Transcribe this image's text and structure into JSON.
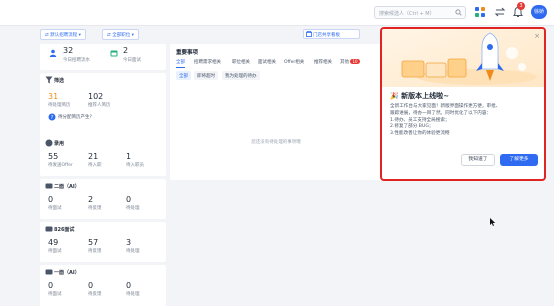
{
  "colors": {
    "accent": "#2e6bf0",
    "highlight": "#e02424",
    "orange": "#f08c1b"
  },
  "topbar": {
    "search_placeholder": "搜索候选人（Ctrl + M）",
    "notification_count": "3",
    "avatar_label": "徐娇"
  },
  "filters": {
    "process_label": "默认招聘流程",
    "position_label": "全部职位"
  },
  "summary": {
    "new_count": "32",
    "new_label": "今日招聘流水",
    "interview_count": "2",
    "interview_label": "今日面试"
  },
  "screening": {
    "title": "筛选",
    "pending_count": "31",
    "pending_label": "待处理简历",
    "recommend_count": "102",
    "recommend_label": "推荐人简历",
    "hint": "待分配简历产生?"
  },
  "hiring": {
    "title": "录用",
    "items": [
      {
        "value": "55",
        "label": "待发送Offer"
      },
      {
        "value": "21",
        "label": "待入职"
      },
      {
        "value": "1",
        "label": "待入职员"
      }
    ]
  },
  "round2": {
    "title": "二面（AI）",
    "items": [
      {
        "value": "0",
        "label": "待面试"
      },
      {
        "value": "2",
        "label": "待反馈"
      },
      {
        "value": "0",
        "label": "待处理"
      }
    ]
  },
  "round826": {
    "title": "826面试",
    "items": [
      {
        "value": "49",
        "label": "待面试"
      },
      {
        "value": "57",
        "label": "待反馈"
      },
      {
        "value": "3",
        "label": "待处理"
      }
    ]
  },
  "round1": {
    "title": "一面（AI）",
    "items": [
      {
        "value": "0",
        "label": "待面试"
      },
      {
        "value": "0",
        "label": "待反馈"
      },
      {
        "value": "0",
        "label": "待处理"
      }
    ]
  },
  "todo": {
    "task_button": "门店共享看板",
    "title": "重要事项",
    "tabs": [
      "全部",
      "招聘需求相关",
      "职位相关",
      "面试相关",
      "Offer相关",
      "推荐相关",
      "其他"
    ],
    "other_badge": "10",
    "chips": [
      "全部",
      "即将超时",
      "我为处理的待办"
    ],
    "empty_text": "您还没有待处理的事项哦"
  },
  "popup": {
    "title": "新版本上线啦~",
    "lines": [
      "全新工作台与大家见面！新版界面操作更方便，审批、",
      "跟踪进展，待办一目了然。同时优化了以下内容：",
      "1.待办、员工支持全局搜索；",
      "2.修复了部分 BUG；",
      "3.性能改善让你的体验更流畅"
    ],
    "later_label": "我知道了",
    "more_label": "了解更多"
  }
}
